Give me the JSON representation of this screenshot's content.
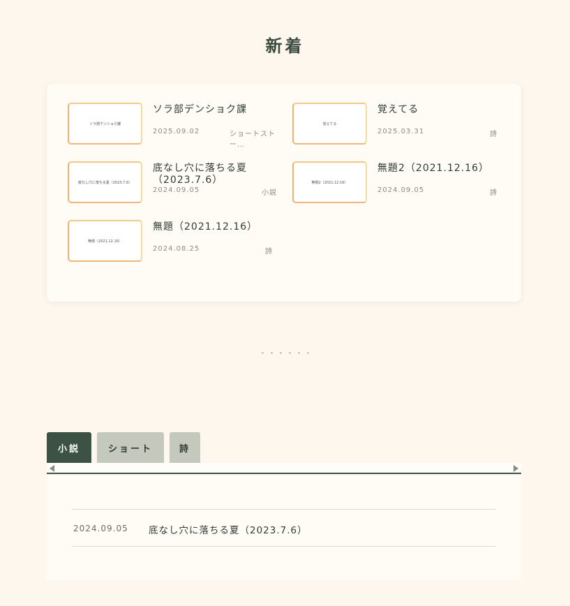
{
  "heading": "新着",
  "items": [
    {
      "thumb": "ソラ部デンショク課",
      "title": "ソラ部デンショク課",
      "date": "2025.09.02",
      "category": "ショートストー…"
    },
    {
      "thumb": "覚えてる",
      "title": "覚えてる",
      "date": "2025.03.31",
      "category": "詩"
    },
    {
      "thumb": "底なし穴に落ちる夏（2023.7.6）",
      "title": "底なし穴に落ちる夏（2023.7.6）",
      "date": "2024.09.05",
      "category": "小説"
    },
    {
      "thumb": "無題2（2021.12.16）",
      "title": "無題2（2021.12.16）",
      "date": "2024.09.05",
      "category": "詩"
    },
    {
      "thumb": "無題（2021.12.16）",
      "title": "無題（2021.12.16）",
      "date": "2024.08.25",
      "category": "詩"
    }
  ],
  "tabs": [
    {
      "label": "小説",
      "active": true
    },
    {
      "label": "ショート",
      "active": false
    },
    {
      "label": "詩",
      "active": false
    }
  ],
  "list": [
    {
      "date": "2024.09.05",
      "title": "底なし穴に落ちる夏（2023.7.6）"
    }
  ],
  "colors": {
    "background": "#fef7ee",
    "accent": "#3b5245",
    "tab_inactive": "#c5c8bd",
    "thumb_border": "#f3c98a"
  }
}
